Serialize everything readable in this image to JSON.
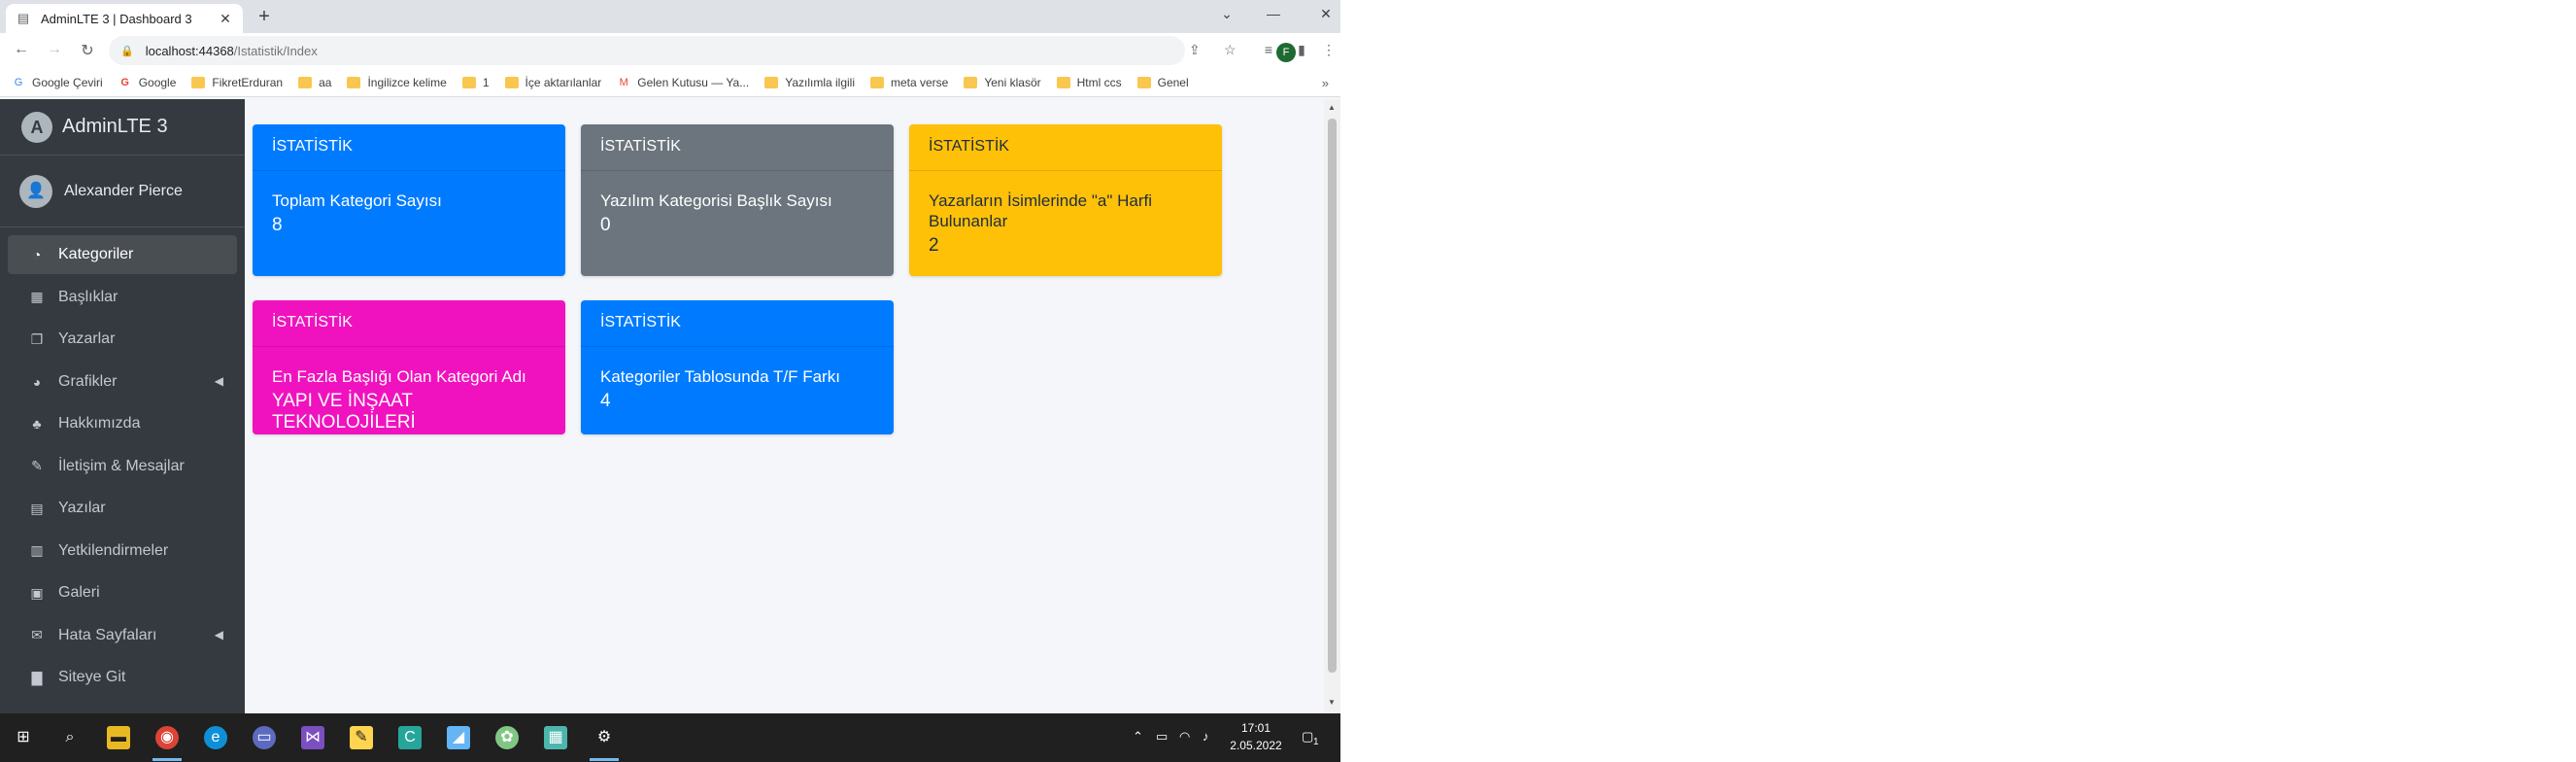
{
  "browser": {
    "tab_title": "AdminLTE 3 | Dashboard 3",
    "new_tab_icon": "plus-icon",
    "url_host": "localhost:44368",
    "url_path": "/Istatistik/Index",
    "profile_letter": "F",
    "bookmarks": [
      {
        "label": "Google Çeviri",
        "icon": "translate-icon"
      },
      {
        "label": "Google",
        "icon": "google-icon"
      },
      {
        "label": "FikretErduran",
        "icon": "folder-icon"
      },
      {
        "label": "aa",
        "icon": "folder-icon"
      },
      {
        "label": "İngilizce kelime",
        "icon": "folder-icon"
      },
      {
        "label": "1",
        "icon": "folder-icon"
      },
      {
        "label": "İçe aktarılanlar",
        "icon": "folder-icon"
      },
      {
        "label": "Gelen Kutusu — Ya...",
        "icon": "mail-icon"
      },
      {
        "label": "Yazılımla ilgili",
        "icon": "folder-icon"
      },
      {
        "label": "meta verse",
        "icon": "folder-icon"
      },
      {
        "label": "Yeni klasör",
        "icon": "folder-icon"
      },
      {
        "label": "Html ccs",
        "icon": "folder-icon"
      },
      {
        "label": "Genel",
        "icon": "folder-icon"
      }
    ]
  },
  "sidebar": {
    "brand": "AdminLTE 3",
    "user_name": "Alexander Pierce",
    "items": [
      {
        "label": "Kategoriler",
        "icon": "dashboard-icon",
        "active": true
      },
      {
        "label": "Başlıklar",
        "icon": "grid-icon"
      },
      {
        "label": "Yazarlar",
        "icon": "copy-icon"
      },
      {
        "label": "Grafikler",
        "icon": "pie-chart-icon",
        "arrow": true
      },
      {
        "label": "Hakkımızda",
        "icon": "tree-icon"
      },
      {
        "label": "İletişim & Mesajlar",
        "icon": "edit-icon"
      },
      {
        "label": "Yazılar",
        "icon": "table-icon"
      },
      {
        "label": "Yetkilendirmeler",
        "icon": "calendar-icon"
      },
      {
        "label": "Galeri",
        "icon": "image-icon"
      },
      {
        "label": "Hata Sayfaları",
        "icon": "envelope-icon",
        "arrow": true
      },
      {
        "label": "Siteye Git",
        "icon": "book-icon"
      }
    ]
  },
  "cards": [
    {
      "header": "İSTATİSTİK",
      "label": "Toplam Kategori Sayısı",
      "value": "8",
      "color": "#007bff"
    },
    {
      "header": "İSTATİSTİK",
      "label": "Yazılım Kategorisi Başlık Sayısı",
      "value": "0",
      "color": "#6c757d"
    },
    {
      "header": "İSTATİSTİK",
      "label": "Yazarların İsimlerinde \"a\" Harfi Bulunanlar",
      "value": "2",
      "color": "#ffc107"
    },
    {
      "header": "İSTATİSTİK",
      "label": "En Fazla Başlığı Olan Kategori Adı",
      "value": "YAPI VE İNŞAAT TEKNOLOJİLERİ",
      "color": "#f012be"
    },
    {
      "header": "İSTATİSTİK",
      "label": "Kategoriler Tablosunda T/F Farkı",
      "value": "4",
      "color": "#007bff"
    }
  ],
  "taskbar": {
    "time": "17:01",
    "date": "2.05.2022",
    "notification_count": "1"
  }
}
